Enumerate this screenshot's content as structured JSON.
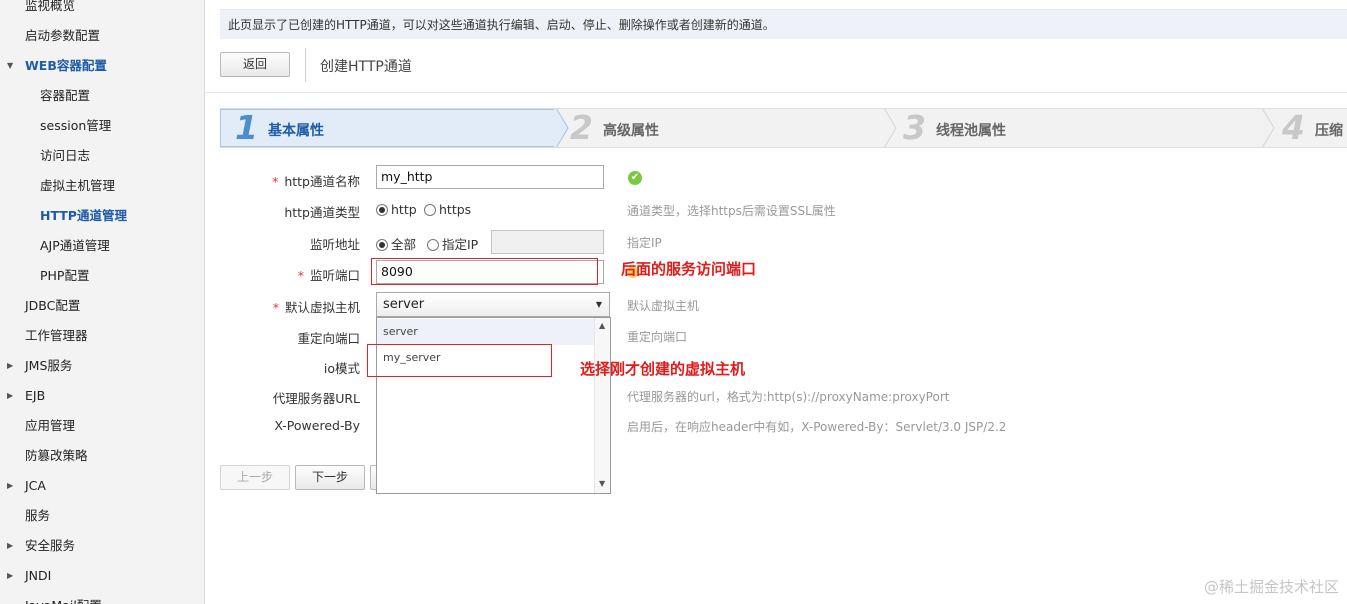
{
  "sidebar": {
    "items": [
      {
        "label": "监视概览",
        "level": 1,
        "arrow": ""
      },
      {
        "label": "启动参数配置",
        "level": 1,
        "arrow": ""
      },
      {
        "label": "WEB容器配置",
        "level": 1,
        "arrow": "▼",
        "active": true
      },
      {
        "label": "容器配置",
        "level": 2,
        "arrow": ""
      },
      {
        "label": "session管理",
        "level": 2,
        "arrow": ""
      },
      {
        "label": "访问日志",
        "level": 2,
        "arrow": ""
      },
      {
        "label": "虚拟主机管理",
        "level": 2,
        "arrow": ""
      },
      {
        "label": "HTTP通道管理",
        "level": 2,
        "arrow": "",
        "active": true
      },
      {
        "label": "AJP通道管理",
        "level": 2,
        "arrow": ""
      },
      {
        "label": "PHP配置",
        "level": 2,
        "arrow": ""
      },
      {
        "label": "JDBC配置",
        "level": 1,
        "arrow": ""
      },
      {
        "label": "工作管理器",
        "level": 1,
        "arrow": ""
      },
      {
        "label": "JMS服务",
        "level": 1,
        "arrow": "▶"
      },
      {
        "label": "EJB",
        "level": 1,
        "arrow": "▶"
      },
      {
        "label": "应用管理",
        "level": 1,
        "arrow": ""
      },
      {
        "label": "防篡改策略",
        "level": 1,
        "arrow": ""
      },
      {
        "label": "JCA",
        "level": 1,
        "arrow": "▶"
      },
      {
        "label": "服务",
        "level": 1,
        "arrow": ""
      },
      {
        "label": "安全服务",
        "level": 1,
        "arrow": "▶"
      },
      {
        "label": "JNDI",
        "level": 1,
        "arrow": "▶"
      },
      {
        "label": "JavaMail配置",
        "level": 1,
        "arrow": ""
      }
    ]
  },
  "info_text": "此页显示了已创建的HTTP通道，可以对这些通道执行编辑、启动、停止、删除操作或者创建新的通道。",
  "toolbar": {
    "back_label": "返回",
    "page_title": "创建HTTP通道"
  },
  "steps": [
    {
      "num": "1",
      "label": "基本属性"
    },
    {
      "num": "2",
      "label": "高级属性"
    },
    {
      "num": "3",
      "label": "线程池属性"
    },
    {
      "num": "4",
      "label": "压缩"
    }
  ],
  "form": {
    "name_label": "http通道名称",
    "name_value": "my_http",
    "type_label": "http通道类型",
    "type_opt1": "http",
    "type_opt2": "https",
    "type_hint": "通道类型，选择https后需设置SSL属性",
    "listen_addr_label": "监听地址",
    "listen_opt1": "全部",
    "listen_opt2": "指定IP",
    "listen_hint": "指定IP",
    "port_label": "监听端口",
    "port_value": "8090",
    "vhost_label": "默认虚拟主机",
    "vhost_value": "server",
    "vhost_hint": "默认虚拟主机",
    "redirect_label": "重定向端口",
    "redirect_hint": "重定向端口",
    "io_label": "io模式",
    "proxy_label": "代理服务器URL",
    "proxy_hint": "代理服务器的url，格式为:http(s)://proxyName:proxyPort",
    "powered_label": "X-Powered-By",
    "powered_hint": "启用后，在响应header中有如，X-Powered-By：Servlet/3.0 JSP/2.2",
    "required_mark": "*"
  },
  "dropdown": {
    "options": [
      "server",
      "my_server"
    ]
  },
  "buttons": {
    "prev_label": "上一步",
    "next_label": "下一步"
  },
  "annotations": {
    "port_note": "后面的服务访问端口",
    "vhost_note": "选择刚才创建的虚拟主机"
  },
  "watermark": "@稀土掘金技术社区"
}
